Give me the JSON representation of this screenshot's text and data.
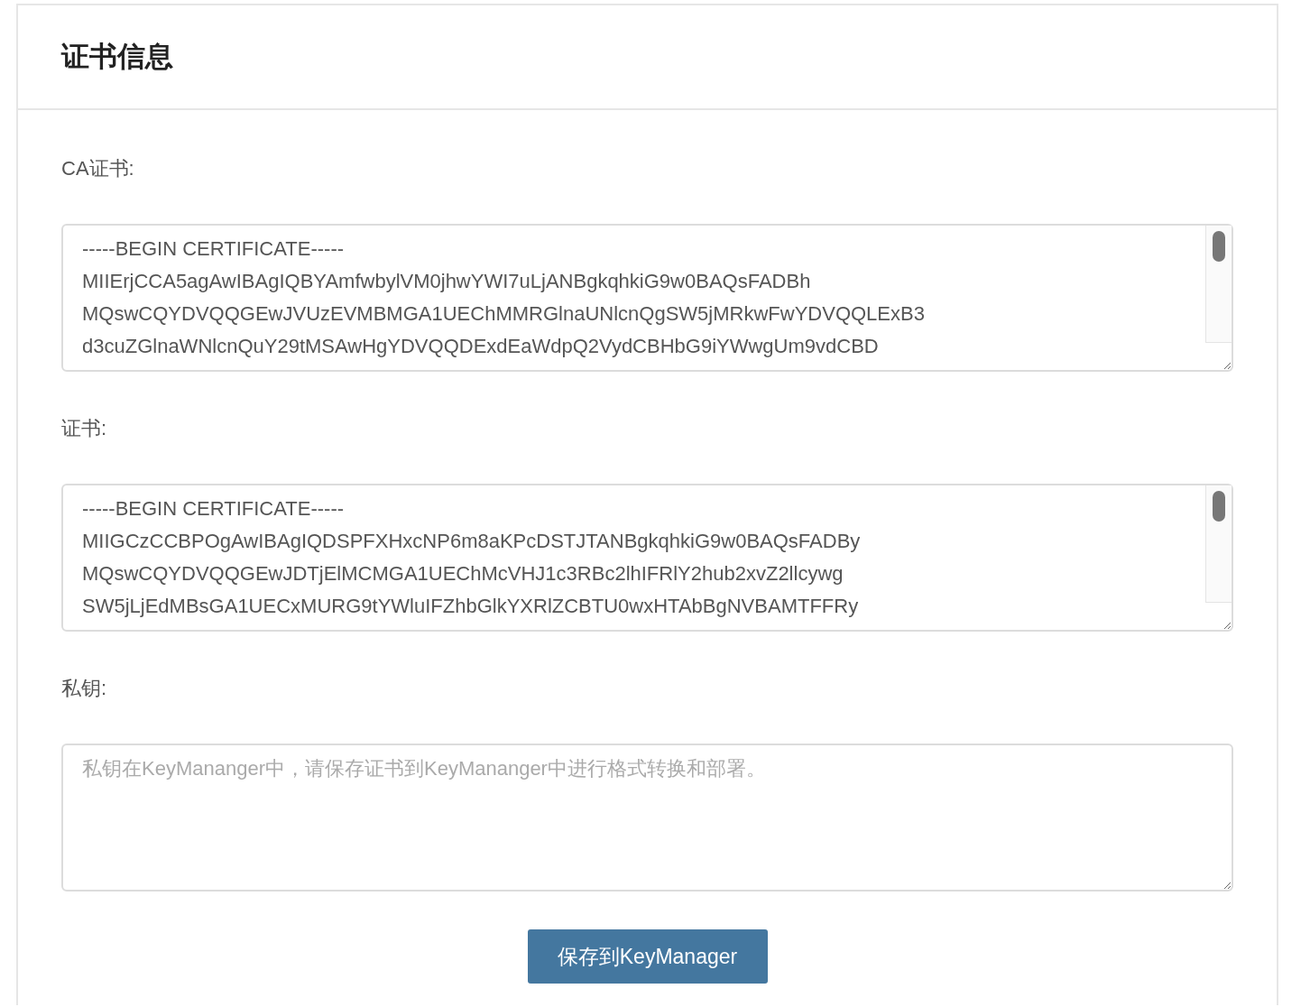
{
  "panel": {
    "title": "证书信息"
  },
  "fields": [
    {
      "label": "CA证书:",
      "kind": "certificate",
      "lines": [
        "-----BEGIN CERTIFICATE-----",
        "MIIErjCCA5agAwIBAgIQBYAmfwbylVM0jhwYWI7uLjANBgkqhkiG9w0BAQsFADBh",
        "MQswCQYDVQQGEwJVUzEVMBMGA1UEChMMRGlnaUNlcnQgSW5jMRkwFwYDVQQLExB3",
        "d3cuZGlnaWNlcnQuY29tMSAwHgYDVQQDExdEaWdpQ2VydCBHbG9iYWwgUm9vdCBD"
      ]
    },
    {
      "label": "证书:",
      "kind": "certificate",
      "lines": [
        "-----BEGIN CERTIFICATE-----",
        "MIIGCzCCBPOgAwIBAgIQDSPFXHxcNP6m8aKPcDSTJTANBgkqhkiG9w0BAQsFADBy",
        "MQswCQYDVQQGEwJDTjElMCMGA1UEChMcVHJ1c3RBc2lhIFRlY2hub2xvZ2llcywg",
        "SW5jLjEdMBsGA1UECxMURG9tYWluIFZhbGlkYXRlZCBTU0wxHTAbBgNVBAMTFFRy"
      ]
    },
    {
      "label": "私钥:",
      "kind": "empty",
      "placeholder": "私钥在KeyMananger中，请保存证书到KeyMananger中进行格式转换和部署。"
    }
  ],
  "save_button": "保存到KeyManager"
}
